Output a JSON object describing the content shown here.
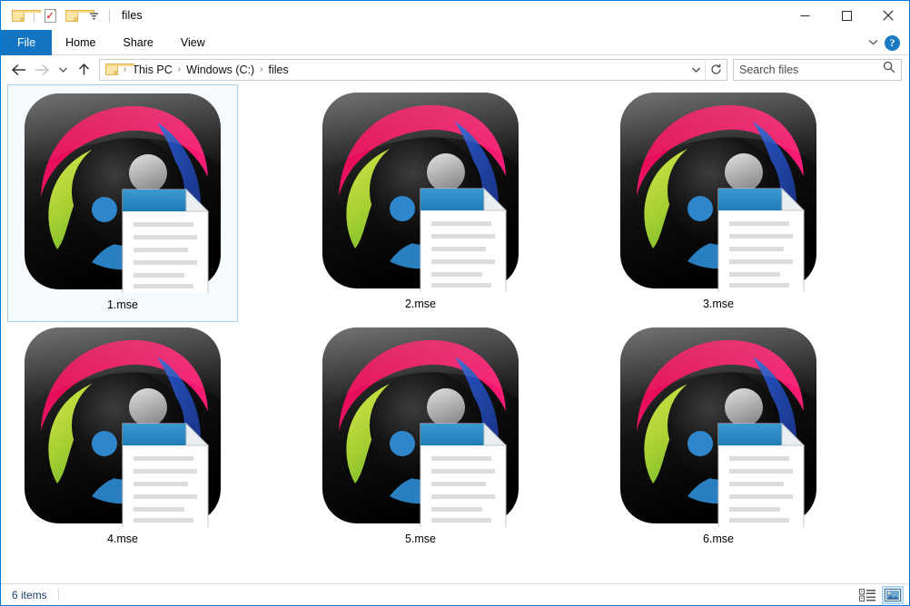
{
  "window": {
    "title": "files",
    "quick_access": [
      {
        "name": "folder-icon",
        "label": "Folder"
      },
      {
        "name": "properties-icon",
        "label": "Properties"
      },
      {
        "name": "new-folder-icon",
        "label": "New folder"
      },
      {
        "name": "chevron-down-icon",
        "label": "Customize Quick Access Toolbar"
      }
    ],
    "caption_buttons": [
      {
        "name": "minimize-button",
        "glyph": "─",
        "label": "Minimize"
      },
      {
        "name": "maximize-button",
        "glyph": "☐",
        "label": "Maximize"
      },
      {
        "name": "close-button",
        "glyph": "✕",
        "label": "Close"
      }
    ]
  },
  "ribbon": {
    "tabs": [
      {
        "label": "File",
        "active": true
      },
      {
        "label": "Home",
        "active": false
      },
      {
        "label": "Share",
        "active": false
      },
      {
        "label": "View",
        "active": false
      }
    ],
    "expand_label": "˅",
    "help_label": "?"
  },
  "address": {
    "back_label": "←",
    "forward_label": "→",
    "recent_label": "˅",
    "up_label": "↑",
    "breadcrumb": [
      "This PC",
      "Windows (C:)",
      "files"
    ],
    "separator": "›",
    "dropdown_label": "˅",
    "refresh_label": "↻"
  },
  "search": {
    "placeholder": "Search files",
    "value": "",
    "icon": "search-icon"
  },
  "files": [
    {
      "name": "1.mse",
      "selected": true
    },
    {
      "name": "2.mse",
      "selected": false
    },
    {
      "name": "3.mse",
      "selected": false
    },
    {
      "name": "4.mse",
      "selected": false
    },
    {
      "name": "5.mse",
      "selected": false
    },
    {
      "name": "6.mse",
      "selected": false
    }
  ],
  "statusbar": {
    "item_count": "6 items",
    "views": [
      {
        "name": "details-view-button",
        "active": false
      },
      {
        "name": "large-icons-view-button",
        "active": true
      }
    ]
  },
  "colors": {
    "accent": "#0078d7",
    "file_tab": "#1475c4",
    "selection_fill": "#f4fafe",
    "selection_border": "#a8d0ea",
    "icon_pink": "#ea0f5e",
    "icon_green": "#9ac92e",
    "icon_blue_dark": "#1d3f9e",
    "icon_blue_mid": "#2a7fc0",
    "icon_black": "#0d0d0d",
    "doc_header_blue": "#2b8cc4",
    "status_text": "#1b3d6d"
  }
}
